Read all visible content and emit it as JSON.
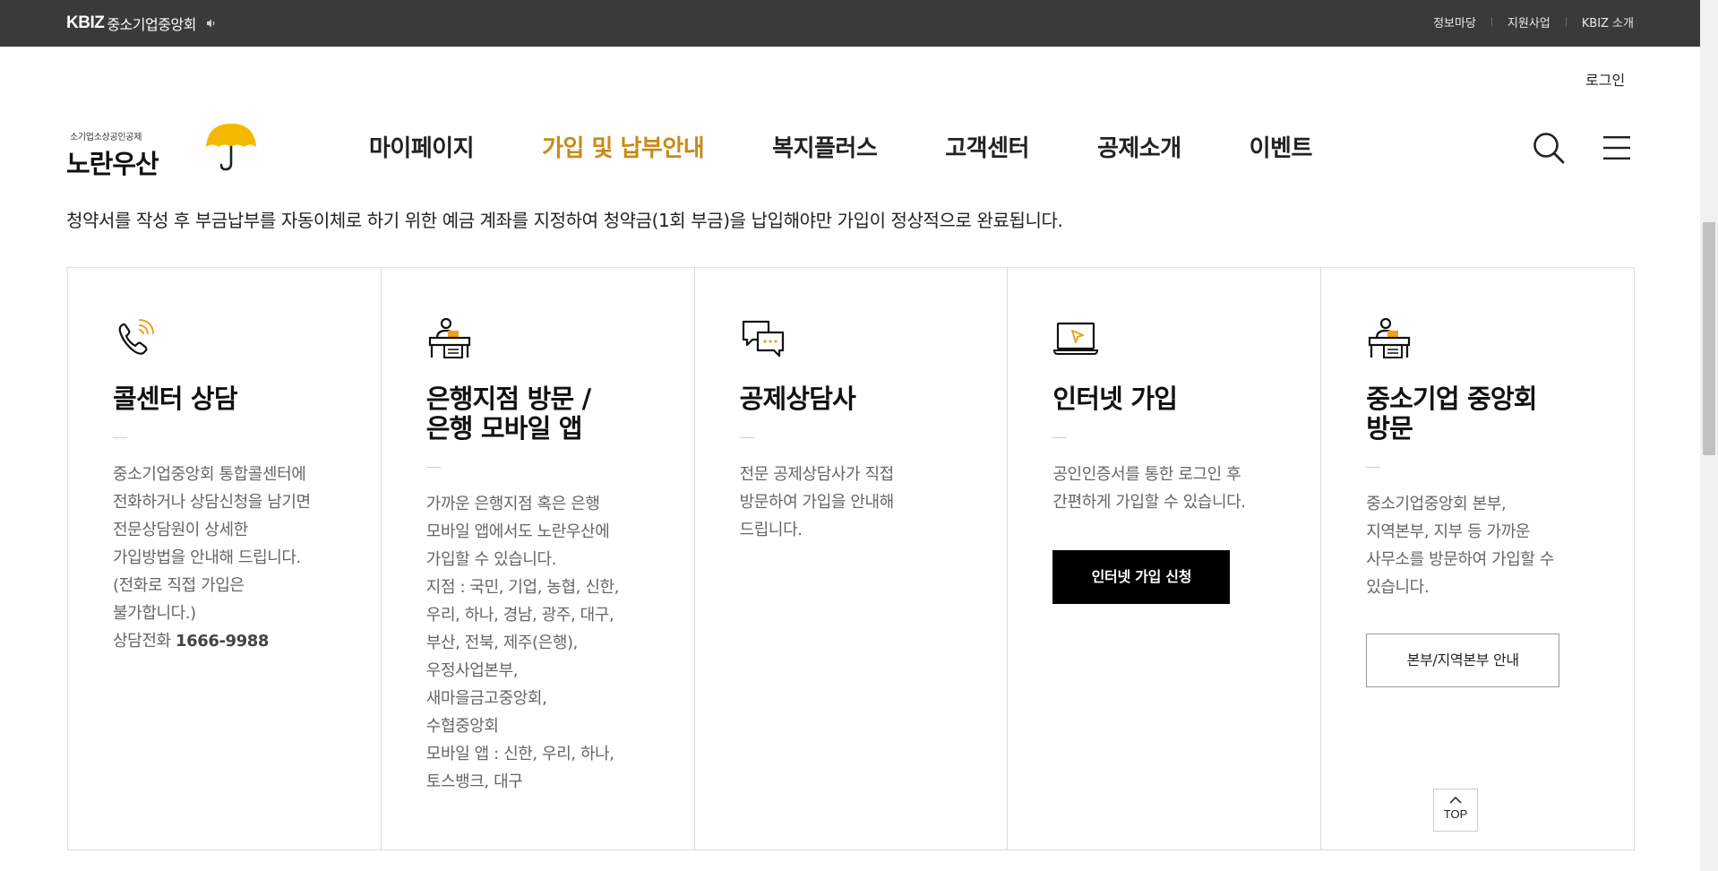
{
  "topbar": {
    "brand_logo": "KBIZ",
    "brand_name": "중소기업중앙회",
    "links": [
      "정보마당",
      "지원사업",
      "KBIZ 소개"
    ]
  },
  "header": {
    "login": "로그인",
    "logo_sub": "소기업소상공인공제",
    "logo_main": "노란우산",
    "nav": [
      "마이페이지",
      "가입 및 납부안내",
      "복지플러스",
      "고객센터",
      "공제소개",
      "이벤트"
    ],
    "active_nav": "가입 및 납부안내"
  },
  "notice": "청약서를 작성 후 부금납부를 자동이체로 하기 위한 예금 계좌를 지정하여 청약금(1회 부금)을 납입해야만 가입이 정상적으로 완료됩니다.",
  "cards": [
    {
      "icon": "phone-icon",
      "title": "콜센터 상담",
      "desc": "중소기업중앙회 통합콜센터에\n전화하거나 상담신청을 남기면\n전문상담원이 상세한\n가입방법을 안내해 드립니다.\n(전화로 직접 가입은\n불가합니다.)",
      "phone_label": "상담전화",
      "phone_number": "1666-9988"
    },
    {
      "icon": "bank-counter-icon",
      "title": "은행지점 방문 /\n은행 모바일 앱",
      "desc": "가까운 은행지점 혹은 은행\n모바일 앱에서도 노란우산에\n가입할 수 있습니다.\n지점 : 국민, 기업, 농협, 신한,\n우리, 하나, 경남, 광주, 대구,\n부산, 전북, 제주(은행),\n우정사업본부,\n새마을금고중앙회,\n수협중앙회\n모바일 앱 : 신한, 우리, 하나,\n토스뱅크, 대구"
    },
    {
      "icon": "chat-bubbles-icon",
      "title": "공제상담사",
      "desc": "전문 공제상담사가 직접\n방문하여 가입을 안내해\n드립니다."
    },
    {
      "icon": "laptop-icon",
      "title": "인터넷 가입",
      "desc": "공인인증서를 통한 로그인 후\n간편하게 가입할 수 있습니다.",
      "button": "인터넷 가입 신청"
    },
    {
      "icon": "office-counter-icon",
      "title": "중소기업 중앙회\n방문",
      "desc": "중소기업중앙회 본부,\n지역본부, 지부 등 가까운\n사무소를 방문하여 가입할 수\n있습니다.",
      "button": "본부/지역본부 안내"
    }
  ],
  "top_button": "TOP",
  "colors": {
    "topbar_bg": "#3a3a3a",
    "accent": "#c88a1a",
    "umbrella": "#f5b800",
    "icon_orange": "#f0a020"
  }
}
